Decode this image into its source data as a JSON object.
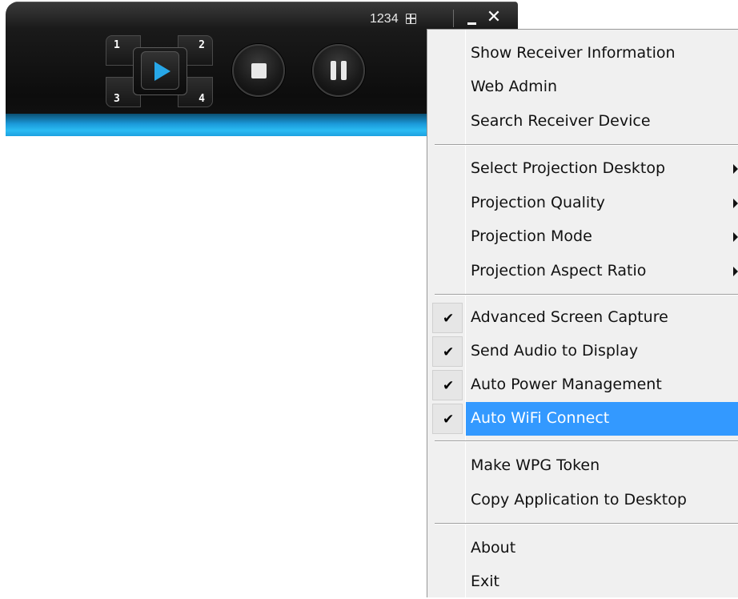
{
  "toolbar": {
    "login_code": "1234",
    "split_quadrants": [
      "1",
      "2",
      "3",
      "4"
    ],
    "icons": {
      "layout": "layout-icon",
      "minimize": "minimize-icon",
      "close": "close-icon",
      "play": "play-icon",
      "stop": "stop-icon",
      "pause": "pause-icon"
    },
    "close_glyph": "✕",
    "accent_color": "#27a7e8"
  },
  "menu": {
    "groups": [
      {
        "items": [
          {
            "label": "Show Receiver Information"
          },
          {
            "label": "Web Admin"
          },
          {
            "label": "Search Receiver Device"
          }
        ]
      },
      {
        "items": [
          {
            "label": "Select Projection Desktop",
            "submenu": true
          },
          {
            "label": "Projection Quality",
            "submenu": true
          },
          {
            "label": "Projection Mode",
            "submenu": true
          },
          {
            "label": "Projection Aspect Ratio",
            "submenu": true
          }
        ]
      },
      {
        "items": [
          {
            "label": "Advanced Screen Capture",
            "checked": true
          },
          {
            "label": "Send Audio to Display",
            "checked": true
          },
          {
            "label": "Auto Power Management",
            "checked": true
          },
          {
            "label": "Auto WiFi Connect",
            "checked": true,
            "highlighted": true
          }
        ]
      },
      {
        "items": [
          {
            "label": "Make WPG Token"
          },
          {
            "label": "Copy Application to Desktop"
          }
        ]
      },
      {
        "items": [
          {
            "label": "About"
          },
          {
            "label": "Exit"
          }
        ]
      }
    ],
    "check_glyph": "✔",
    "highlight_color": "#3399ff"
  }
}
